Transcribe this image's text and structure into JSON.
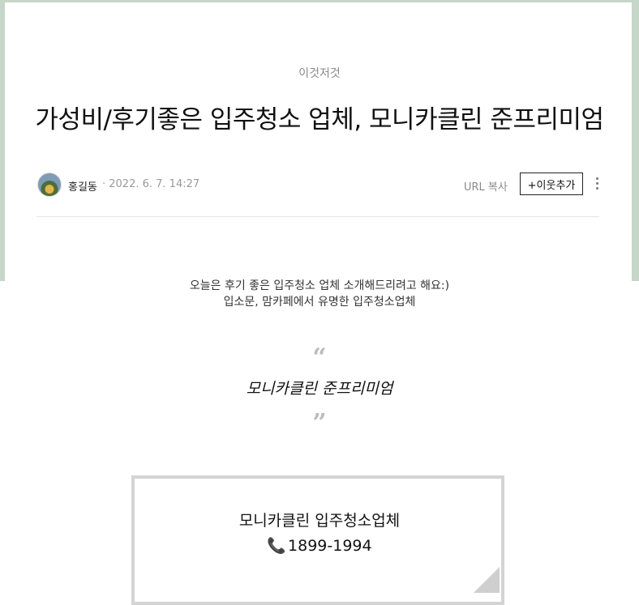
{
  "post": {
    "category": "이것저것",
    "title": "가성비/후기좋은 입주청소 업체, 모니카클린 준프리미엄",
    "author": "홍길동",
    "date": "· 2022. 6. 7. 14:27",
    "url_copy_label": "URL 복사",
    "add_neighbor_label": "+이웃추가"
  },
  "body": {
    "intro_line1": "오늘은 후기 좋은 입주청소 업체 소개해드리려고 해요:)",
    "intro_line2": "입소문, 맘카페에서 유명한 입주청소업체",
    "quote_text": "모니카클린 준프리미엄",
    "box_title": "모니카클린 입주청소업체",
    "box_phone": "1899-1994"
  },
  "icons": {
    "quote_open": "“",
    "quote_close": "”",
    "phone": "📞"
  },
  "colors": {
    "frame_green": "#c6d6c8",
    "box_border": "#d4d4d4"
  }
}
